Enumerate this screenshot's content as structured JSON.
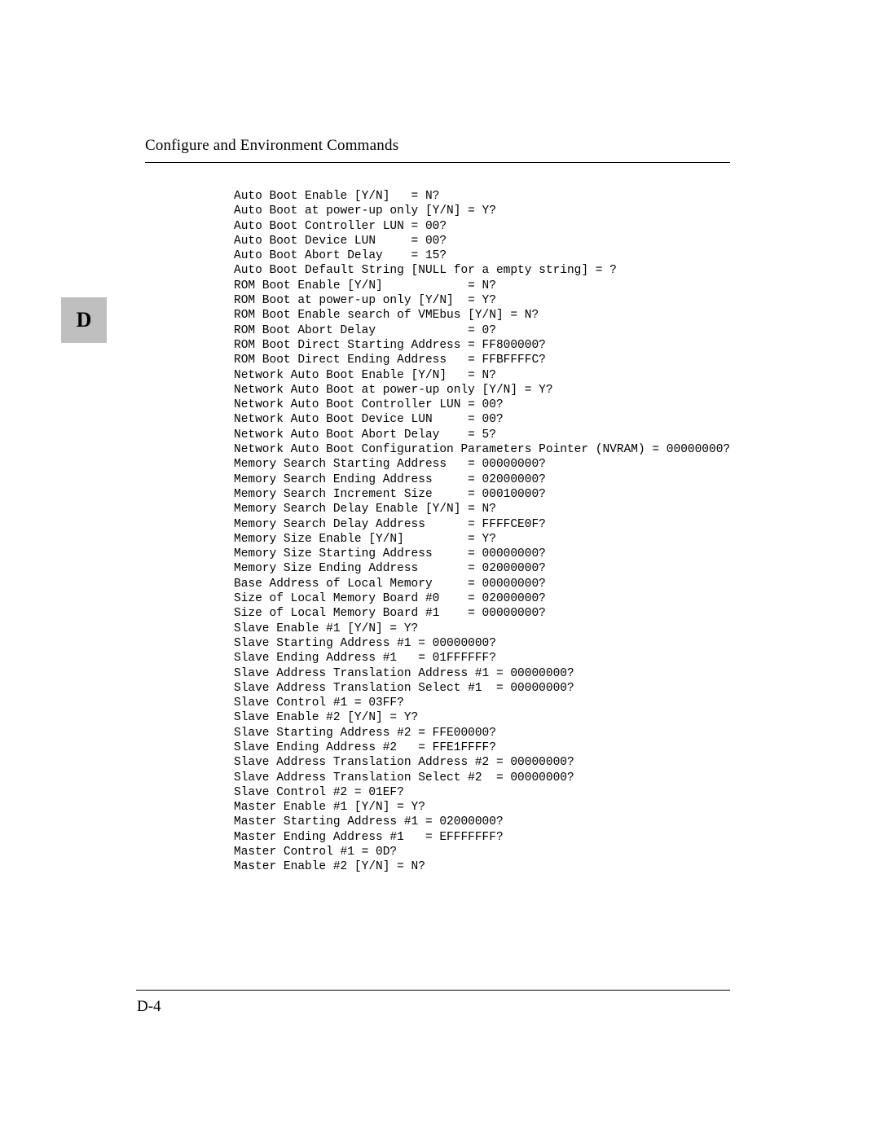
{
  "header": {
    "title": "Configure and Environment Commands"
  },
  "tab": {
    "label": "D"
  },
  "body": {
    "lines": [
      "Auto Boot Enable [Y/N]   = N?",
      "Auto Boot at power-up only [Y/N] = Y?",
      "Auto Boot Controller LUN = 00?",
      "Auto Boot Device LUN     = 00?",
      "Auto Boot Abort Delay    = 15?",
      "Auto Boot Default String [NULL for a empty string] = ?",
      "ROM Boot Enable [Y/N]            = N?",
      "ROM Boot at power-up only [Y/N]  = Y?",
      "ROM Boot Enable search of VMEbus [Y/N] = N?",
      "ROM Boot Abort Delay             = 0?",
      "ROM Boot Direct Starting Address = FF800000?",
      "ROM Boot Direct Ending Address   = FFBFFFFC?",
      "Network Auto Boot Enable [Y/N]   = N?",
      "Network Auto Boot at power-up only [Y/N] = Y?",
      "Network Auto Boot Controller LUN = 00?",
      "Network Auto Boot Device LUN     = 00?",
      "Network Auto Boot Abort Delay    = 5?",
      "Network Auto Boot Configuration Parameters Pointer (NVRAM) = 00000000?",
      "Memory Search Starting Address   = 00000000?",
      "Memory Search Ending Address     = 02000000?",
      "Memory Search Increment Size     = 00010000?",
      "Memory Search Delay Enable [Y/N] = N?",
      "Memory Search Delay Address      = FFFFCE0F?",
      "Memory Size Enable [Y/N]         = Y?",
      "Memory Size Starting Address     = 00000000?",
      "Memory Size Ending Address       = 02000000?",
      "Base Address of Local Memory     = 00000000?",
      "Size of Local Memory Board #0    = 02000000?",
      "Size of Local Memory Board #1    = 00000000?",
      "Slave Enable #1 [Y/N] = Y?",
      "Slave Starting Address #1 = 00000000?",
      "Slave Ending Address #1   = 01FFFFFF?",
      "Slave Address Translation Address #1 = 00000000?",
      "Slave Address Translation Select #1  = 00000000?",
      "Slave Control #1 = 03FF?",
      "Slave Enable #2 [Y/N] = Y?",
      "Slave Starting Address #2 = FFE00000?",
      "Slave Ending Address #2   = FFE1FFFF?",
      "Slave Address Translation Address #2 = 00000000?",
      "Slave Address Translation Select #2  = 00000000?",
      "Slave Control #2 = 01EF?",
      "Master Enable #1 [Y/N] = Y?",
      "Master Starting Address #1 = 02000000?",
      "Master Ending Address #1   = EFFFFFFF?",
      "Master Control #1 = 0D?",
      "Master Enable #2 [Y/N] = N?"
    ]
  },
  "footer": {
    "page": "D-4"
  }
}
